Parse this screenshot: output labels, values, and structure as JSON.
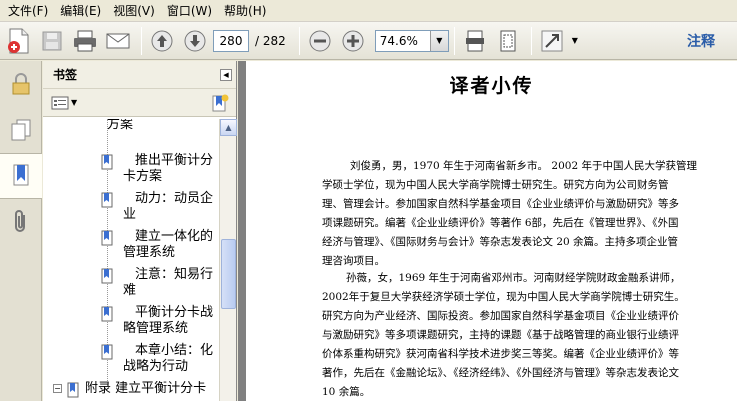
{
  "menu": [
    "文件(F)",
    "编辑(E)",
    "视图(V)",
    "窗口(W)",
    "帮助(H)"
  ],
  "toolbar": {
    "current_page": "280",
    "page_total": "/ 282",
    "zoom": "74.6%",
    "annotate_label": "注释"
  },
  "bookmarks_panel": {
    "title": "书签",
    "items": [
      {
        "text": "方案"
      },
      {
        "text": "推出平衡计分卡方案"
      },
      {
        "text": "动力：动员企业"
      },
      {
        "text": "建立一体化的管理系统"
      },
      {
        "text": "注意：知易行难"
      },
      {
        "text": "平衡计分卡战略管理系统"
      },
      {
        "text": "本章小结：化战略为行动"
      },
      {
        "text": "附录 建立平衡计分卡"
      }
    ]
  },
  "document": {
    "title": "译者小传",
    "lines": [
      "刘俊勇，男，1970 年生于河南省新乡市。 2002 年于中国人民大学获管理",
      "学硕士学位，现为中国人民大学商学院博士研究生。研究方向为公司财务管",
      "理、管理会计。参加国家自然科学基金项目《企业业绩评价与激励研究》等多",
      "项课题研究。编著《企业业绩评价》等著作 6部，先后在《管理世界》、《外国",
      "经济与管理》、《国际财务与会计》等杂志发表论文 20 余篇。主持多项企业管",
      "理咨询项目。",
      "孙薇，女，1969 年生于河南省邓州市。河南财经学院财政金融系讲师，",
      "2002年于复旦大学获经济学硕士学位，现为中国人民大学商学院博士研究生。",
      "研究方向为产业经济、国际投资。参加国家自然科学基金项目《企业业绩评价",
      "与激励研究》等多项课题研究，主持的课题《基于战略管理的商业银行业绩评",
      "价体系重构研究》获河南省科学技术进步奖三等奖。编著《企业业绩评价》等",
      "著作，先后在《金融论坛》、《经济经纬》、《外国经济与管理》等杂志发表论文",
      "10 余篇。"
    ]
  }
}
